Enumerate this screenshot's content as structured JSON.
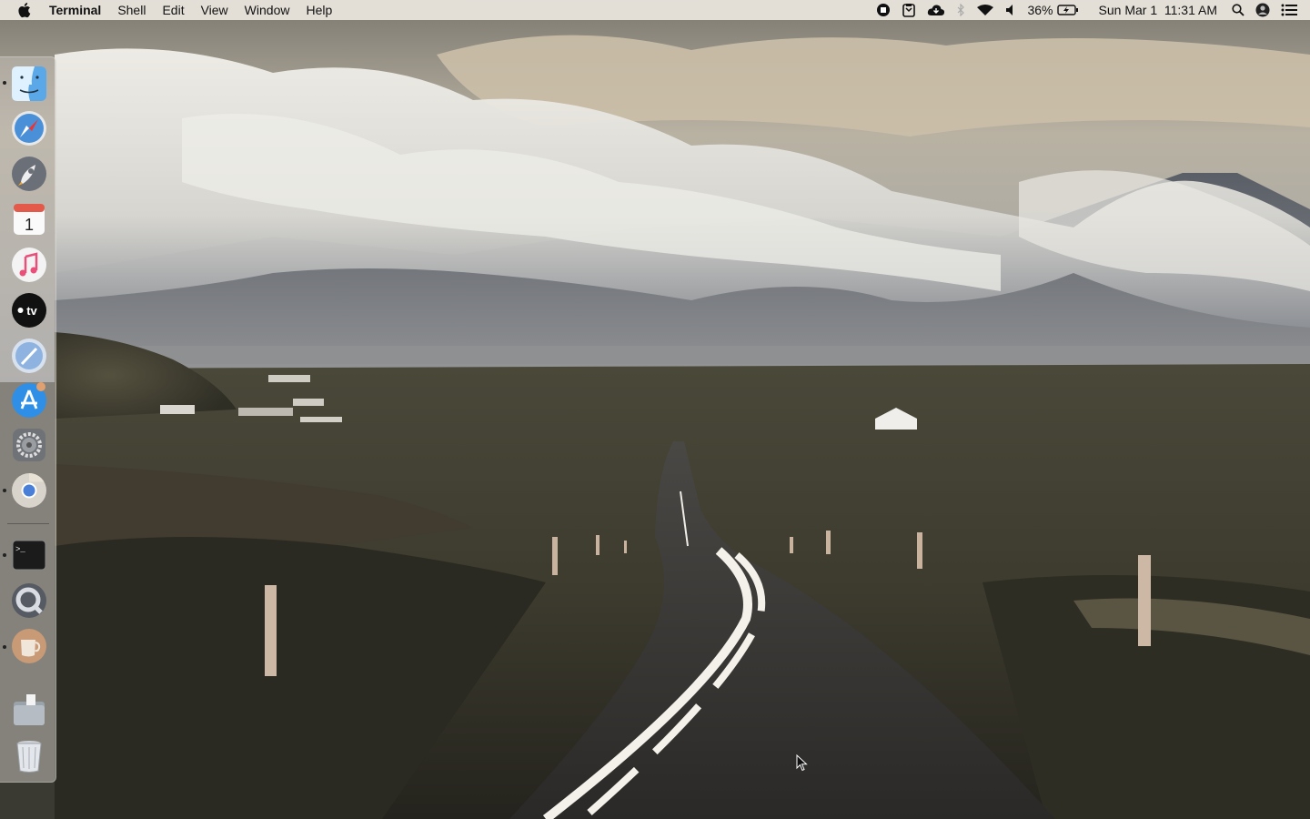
{
  "menubar": {
    "app_name": "Terminal",
    "menus": [
      "Shell",
      "Edit",
      "View",
      "Window",
      "Help"
    ],
    "battery_percent": "36%",
    "datetime": "Sun Mar 1  11:31 AM",
    "status_icons": [
      "record-stop-icon",
      "clipboard-icon",
      "cloud-icon",
      "bluetooth-icon",
      "wifi-icon",
      "volume-icon",
      "battery-charging-icon",
      "spotlight-search-icon",
      "user-avatar-icon",
      "notification-center-icon"
    ]
  },
  "dock": {
    "apps": [
      {
        "name": "Finder",
        "icon": "finder-icon",
        "running": true
      },
      {
        "name": "Safari",
        "icon": "safari-icon",
        "running": false
      },
      {
        "name": "Launchpad",
        "icon": "launchpad-icon",
        "running": false
      },
      {
        "name": "Calendar",
        "icon": "calendar-icon",
        "running": false,
        "day": "1"
      },
      {
        "name": "Music",
        "icon": "music-icon",
        "running": false
      },
      {
        "name": "TV",
        "icon": "apple-tv-icon",
        "running": false,
        "label": "tv"
      },
      {
        "name": "Feedback",
        "icon": "feedback-icon",
        "running": false
      },
      {
        "name": "App Store",
        "icon": "app-store-icon",
        "running": false
      },
      {
        "name": "System Preferences",
        "icon": "system-preferences-icon",
        "running": false
      },
      {
        "name": "Chrome",
        "icon": "chrome-icon",
        "running": true
      },
      {
        "name": "Terminal",
        "icon": "terminal-icon",
        "running": true,
        "prompt": ">_"
      },
      {
        "name": "QuickTime Player",
        "icon": "quicktime-icon",
        "running": false
      },
      {
        "name": "Coffee App",
        "icon": "coffee-cup-icon",
        "running": true
      }
    ],
    "folders": [
      {
        "name": "Downloads",
        "icon": "folder-stack-icon"
      },
      {
        "name": "Trash",
        "icon": "trash-icon"
      }
    ]
  },
  "colors": {
    "sky": "#bdb8ac",
    "cloud": "#e6e4de",
    "mountain": "#4f5257",
    "field": "#3b3a2c",
    "road": "#2c2b29",
    "road_line": "#f3f1e9"
  }
}
